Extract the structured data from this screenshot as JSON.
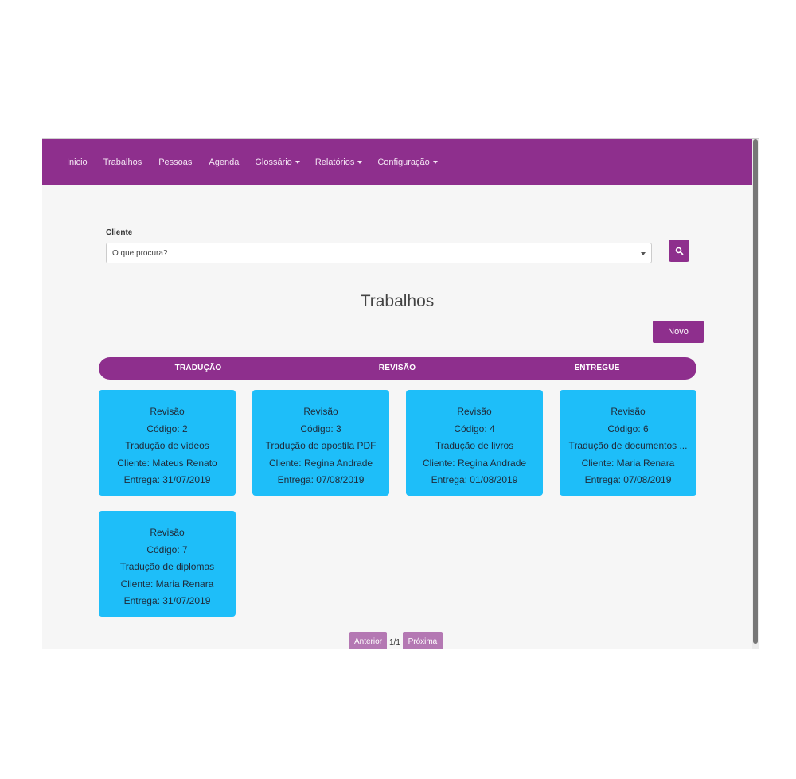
{
  "nav": {
    "items": [
      {
        "label": "Inicio",
        "dropdown": false
      },
      {
        "label": "Trabalhos",
        "dropdown": false
      },
      {
        "label": "Pessoas",
        "dropdown": false
      },
      {
        "label": "Agenda",
        "dropdown": false
      },
      {
        "label": "Glossário",
        "dropdown": true
      },
      {
        "label": "Relatórios",
        "dropdown": true
      },
      {
        "label": "Configuração",
        "dropdown": true
      }
    ]
  },
  "filter": {
    "label": "Cliente",
    "select_value": "O que procura?"
  },
  "page": {
    "title": "Trabalhos",
    "new_button": "Novo"
  },
  "status_tabs": [
    "TRADUÇÃO",
    "REVISÃO",
    "ENTREGUE"
  ],
  "cards": [
    {
      "status": "Revisão",
      "code": "Código: 2",
      "title": "Tradução de vídeos",
      "client": "Cliente: Mateus Renato",
      "delivery": "Entrega: 31/07/2019"
    },
    {
      "status": "Revisão",
      "code": "Código: 3",
      "title": "Tradução de apostila PDF",
      "client": "Cliente: Regina Andrade",
      "delivery": "Entrega: 07/08/2019"
    },
    {
      "status": "Revisão",
      "code": "Código: 4",
      "title": "Tradução de livros",
      "client": "Cliente: Regina Andrade",
      "delivery": "Entrega: 01/08/2019"
    },
    {
      "status": "Revisão",
      "code": "Código: 6",
      "title": "Tradução de documentos ...",
      "client": "Cliente: Maria Renara",
      "delivery": "Entrega: 07/08/2019"
    },
    {
      "status": "Revisão",
      "code": "Código: 7",
      "title": "Tradução de diplomas",
      "client": "Cliente: Maria Renara",
      "delivery": "Entrega: 31/07/2019"
    }
  ],
  "pagination": {
    "prev_label": "Anterior",
    "page_info": "1/1",
    "next_label": "Próxima"
  },
  "colors": {
    "brand": "#8e2f8d",
    "card": "#1ebef9",
    "pager": "#b478b3"
  },
  "icons": {
    "search_button": "search-icon",
    "select": "chevron-down-icon",
    "dropdowns": "caret-down-icon"
  }
}
